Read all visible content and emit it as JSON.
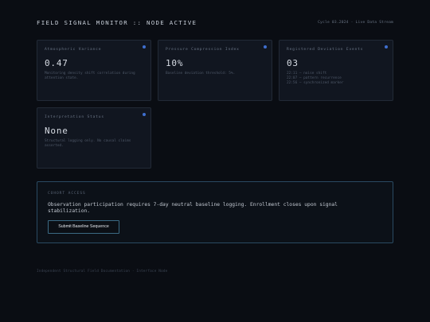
{
  "header": {
    "title": "FIELD SIGNAL MONITOR :: NODE ACTIVE",
    "meta": "Cycle 03.2024 · Live Data Stream"
  },
  "cards": [
    {
      "label": "Atmospheric Variance",
      "value": "0.47",
      "description": "Monitoring density shift correlation during attention state."
    },
    {
      "label": "Pressure Compression Index",
      "value": "10%",
      "description": "Baseline deviation threshold: 5%."
    },
    {
      "label": "Registered Deviation Events",
      "value": "03",
      "events": [
        "22:11 – noise shift",
        "22:07 – pattern recurrence",
        "22:56 – synchronized marker"
      ]
    },
    {
      "label": "Interpretation Status",
      "value": "None",
      "description": "Structural logging only. No causal claims asserted."
    }
  ],
  "access": {
    "label": "COHORT ACCESS",
    "text": "Observation participation requires 7-day neutral baseline logging. Enrollment closes upon signal stabilization.",
    "button_label": "Submit Baseline Sequence"
  },
  "footer": {
    "text": "Independent Structural Field Documentation · Interface Node"
  },
  "colors": {
    "background": "#0a0d13",
    "card": "#111620",
    "indicator_dot": "#3f6fcf",
    "access_border": "#2a4a62"
  }
}
